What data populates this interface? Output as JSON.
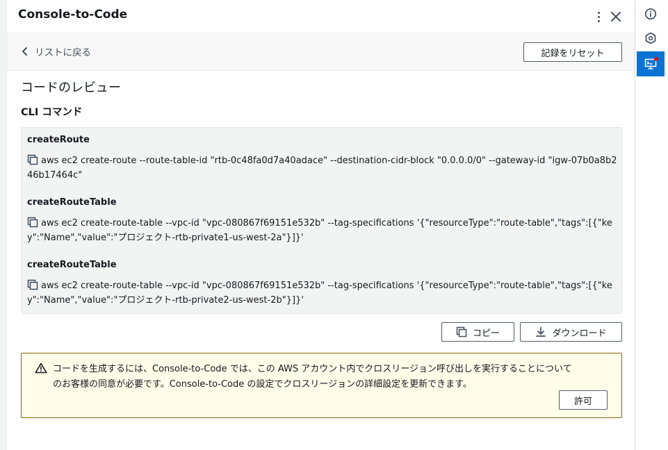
{
  "panel": {
    "title": "Console-to-Code"
  },
  "subbar": {
    "back_label": "リストに戻る",
    "reset_label": "記録をリセット"
  },
  "review": {
    "section_title": "コードのレビュー",
    "cli_heading": "CLI コマンド"
  },
  "commands": [
    {
      "name": "createRoute",
      "text": "aws ec2 create-route --route-table-id \"rtb-0c48fa0d7a40adace\" --destination-cidr-block \"0.0.0.0/0\" --gateway-id \"igw-07b0a8b246b17464c\""
    },
    {
      "name": "createRouteTable",
      "text": "aws ec2 create-route-table --vpc-id \"vpc-080867f69151e532b\" --tag-specifications '{\"resourceType\":\"route-table\",\"tags\":[{\"key\":\"Name\",\"value\":\"プロジェクト-rtb-private1-us-west-2a\"}]}'"
    },
    {
      "name": "createRouteTable",
      "text": "aws ec2 create-route-table --vpc-id \"vpc-080867f69151e532b\" --tag-specifications '{\"resourceType\":\"route-table\",\"tags\":[{\"key\":\"Name\",\"value\":\"プロジェクト-rtb-private2-us-west-2b\"}]}'"
    }
  ],
  "actions": {
    "copy_label": "コピー",
    "download_label": "ダウンロード"
  },
  "alert": {
    "line1": "コードを生成するには、Console-to-Code では、この AWS アカウント内でクロスリージョン呼び出しを実行することについて",
    "line2": "のお客様の同意が必要です。Console-to-Code の設定でクロスリージョンの詳細設定を更新できます。",
    "allow_label": "許可"
  },
  "rail": {
    "items": [
      {
        "icon": "info-icon",
        "active": false
      },
      {
        "icon": "hexagon-icon",
        "active": false
      },
      {
        "icon": "console-to-code-icon",
        "active": true,
        "notification": true
      }
    ]
  },
  "colors": {
    "accent": "#0972d3",
    "warning_border": "#8d6605",
    "warning_bg": "#fffce9",
    "notification": "#d91515"
  }
}
